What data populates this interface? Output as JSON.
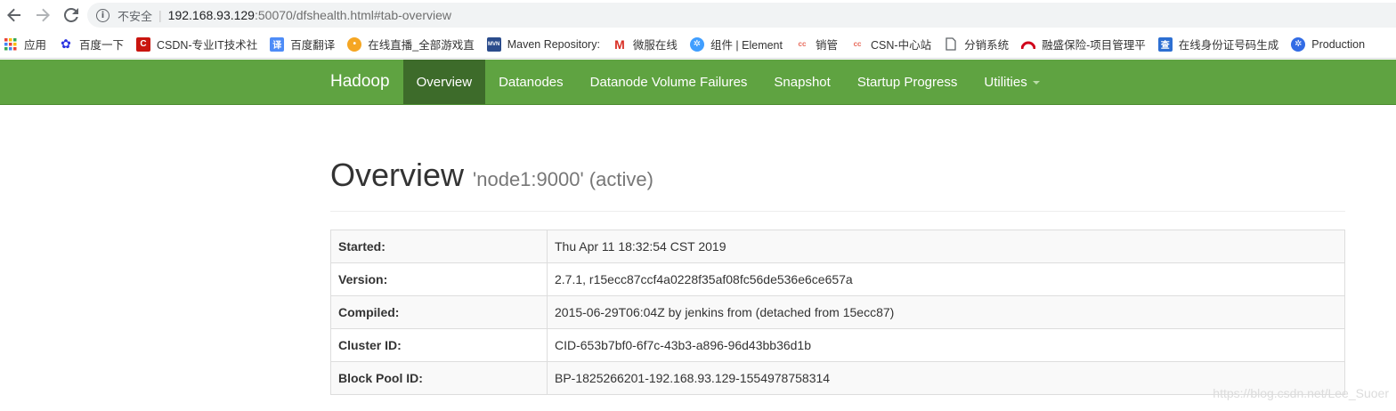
{
  "browser": {
    "security_label": "不安全",
    "url_host": "192.168.93.129",
    "url_rest": ":50070/dfshealth.html#tab-overview",
    "bookmarks": [
      {
        "label": "应用",
        "icon": "apps-grid-icon",
        "color": "#e94235"
      },
      {
        "label": "百度一下",
        "icon": "baidu-paw-icon",
        "color": "#2932e1"
      },
      {
        "label": "CSDN-专业IT技术社",
        "icon": "csdn-icon",
        "color": "#c9150f"
      },
      {
        "label": "百度翻译",
        "icon": "baidu-translate-icon",
        "color": "#4e8cf7"
      },
      {
        "label": "在线直播_全部游戏直",
        "icon": "live-stream-icon",
        "color": "#f5a623"
      },
      {
        "label": "Maven Repository:",
        "icon": "maven-icon",
        "color": "#2b4c8c"
      },
      {
        "label": "微服在线",
        "icon": "gmail-m-icon",
        "color": "#d93025"
      },
      {
        "label": "组件 | Element",
        "icon": "element-icon",
        "color": "#409eff"
      },
      {
        "label": "销管",
        "icon": "doc-red-icon",
        "color": "#e86a5a"
      },
      {
        "label": "CSN-中心站",
        "icon": "doc-red-icon",
        "color": "#e86a5a"
      },
      {
        "label": "分销系统",
        "icon": "page-icon",
        "color": "#5f6368"
      },
      {
        "label": "融盛保险-项目管理平",
        "icon": "arc-icon",
        "color": "#d0021b"
      },
      {
        "label": "在线身份证号码生成",
        "icon": "search-cha-icon",
        "color": "#2d6fd2"
      },
      {
        "label": "Production",
        "icon": "kubernetes-icon",
        "color": "#326ce5"
      }
    ]
  },
  "navbar": {
    "brand": "Hadoop",
    "items": [
      {
        "label": "Overview",
        "active": true
      },
      {
        "label": "Datanodes"
      },
      {
        "label": "Datanode Volume Failures"
      },
      {
        "label": "Snapshot"
      },
      {
        "label": "Startup Progress"
      },
      {
        "label": "Utilities",
        "dropdown": true
      }
    ]
  },
  "overview": {
    "title": "Overview",
    "subtitle": "'node1:9000' (active)",
    "rows": [
      {
        "key": "Started:",
        "value": "Thu Apr 11 18:32:54 CST 2019"
      },
      {
        "key": "Version:",
        "value": "2.7.1, r15ecc87ccf4a0228f35af08fc56de536e6ce657a"
      },
      {
        "key": "Compiled:",
        "value": "2015-06-29T06:04Z by jenkins from (detached from 15ecc87)"
      },
      {
        "key": "Cluster ID:",
        "value": "CID-653b7bf0-6f7c-43b3-a896-96d43bb36d1b"
      },
      {
        "key": "Block Pool ID:",
        "value": "BP-1825266201-192.168.93.129-1554978758314"
      }
    ]
  },
  "watermark": "https://blog.csdn.net/Lee_Suoer"
}
